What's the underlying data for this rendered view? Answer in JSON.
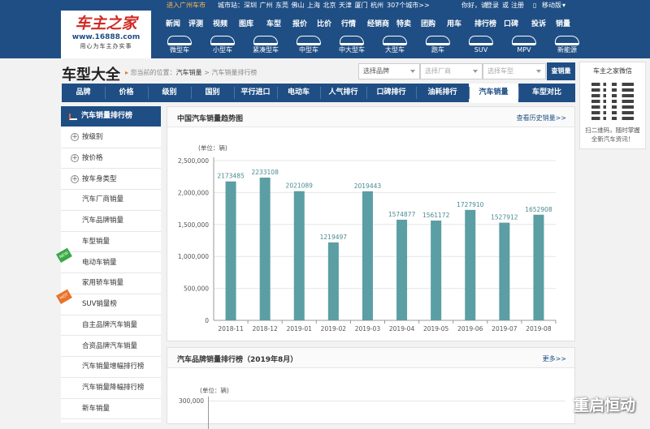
{
  "topbar": {
    "city_enter": "进入广州车市",
    "cities_label": "城市站：",
    "cities": [
      "深圳",
      "广州",
      "东莞",
      "佛山",
      "上海",
      "北京",
      "天津",
      "厦门",
      "杭州"
    ],
    "more_cities": "307个城市>>",
    "auth": [
      "你好，请",
      "登录",
      "或",
      "注册"
    ],
    "mobile": "移动版"
  },
  "logo": {
    "name": "车主之家",
    "domain": "www.16888.com",
    "slogan": "用心为车主办实事"
  },
  "nav": [
    "新闻",
    "评测",
    "视频",
    "图库",
    "车型",
    "报价",
    "比价",
    "行情",
    "经销商",
    "特卖",
    "团购",
    "用车",
    "排行榜",
    "口碑",
    "投诉",
    "销量"
  ],
  "car_types": [
    "微型车",
    "小型车",
    "紧凑型车",
    "中型车",
    "中大型车",
    "大型车",
    "跑车",
    "SUV",
    "MPV",
    "新能源"
  ],
  "page_title": "车型大全",
  "breadcrumb": {
    "prefix": "您当前的位置：",
    "level1": "汽车销量",
    "sep": ">",
    "level2": "汽车销量排行榜"
  },
  "selects": {
    "brand": "选择品牌",
    "maker": "选择厂商",
    "model": "选择车型"
  },
  "query_button": "查销量",
  "tabs": [
    "品牌",
    "价格",
    "级别",
    "国别",
    "平行进口",
    "电动车",
    "人气排行",
    "口碑排行",
    "油耗排行",
    "汽车销量",
    "车型对比"
  ],
  "active_tab": 9,
  "sidebar": {
    "header": "汽车销量排行榜",
    "items": [
      {
        "label": "按级别",
        "type": "plus"
      },
      {
        "label": "按价格",
        "type": "plus"
      },
      {
        "label": "按车身类型",
        "type": "plus"
      },
      {
        "label": "汽车厂商销量",
        "type": "plain"
      },
      {
        "label": "汽车品牌销量",
        "type": "plain"
      },
      {
        "label": "车型销量",
        "type": "plain"
      },
      {
        "label": "电动车销量",
        "type": "plain",
        "badge": "NEW",
        "badge_color": "#3aa845"
      },
      {
        "label": "家用轿车销量",
        "type": "plain"
      },
      {
        "label": "SUV销量榜",
        "type": "plain",
        "badge": "HOT",
        "badge_color": "#e8732a"
      },
      {
        "label": "自主品牌汽车销量",
        "type": "plain"
      },
      {
        "label": "合资品牌汽车销量",
        "type": "plain"
      },
      {
        "label": "汽车销量增幅排行榜",
        "type": "plain"
      },
      {
        "label": "汽车销量降幅排行榜",
        "type": "plain"
      },
      {
        "label": "新车销量",
        "type": "plain"
      }
    ]
  },
  "panel1": {
    "title": "中国汽车销量趋势图",
    "link": "查看历史销量>>"
  },
  "panel2": {
    "title": "汽车品牌销量排行榜（2019年8月）",
    "link": "更多>>",
    "unit": "(单位：辆)",
    "ytop": "300,000"
  },
  "qr": {
    "title": "车主之家微信",
    "caption": "扫二维码，随时掌握全新汽车资讯！"
  },
  "watermark": "重启恒动",
  "colors": {
    "brand_blue": "#1f4e84",
    "bar": "#5b9ea4",
    "accent": "#d02a24"
  },
  "chart_data": {
    "type": "bar",
    "unit_label": "(单位：辆)",
    "categories": [
      "2018-11",
      "2018-12",
      "2019-01",
      "2019-02",
      "2019-03",
      "2019-04",
      "2019-05",
      "2019-06",
      "2019-07",
      "2019-08"
    ],
    "values": [
      2173485,
      2233108,
      2021089,
      1219497,
      2019443,
      1574877,
      1561172,
      1727910,
      1527912,
      1652908
    ],
    "yticks": [
      "0",
      "500,000",
      "1,000,000",
      "1,500,000",
      "2,000,000",
      "2,500,000"
    ],
    "ylim": [
      0,
      2500000
    ],
    "grid": true
  }
}
